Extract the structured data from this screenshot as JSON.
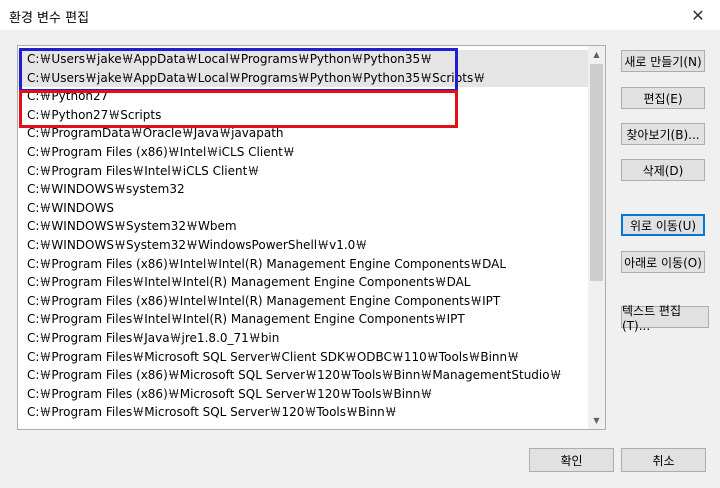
{
  "window": {
    "title": "환경 변수 편집",
    "close_glyph": "✕"
  },
  "entries": [
    "C:￦Users￦jake￦AppData￦Local￦Programs￦Python￦Python35￦",
    "C:￦Users￦jake￦AppData￦Local￦Programs￦Python￦Python35￦Scripts￦",
    "C:￦Python27",
    "C:￦Python27￦Scripts",
    "C:￦ProgramData￦Oracle￦Java￦javapath",
    "C:￦Program Files (x86)￦Intel￦iCLS Client￦",
    "C:￦Program Files￦Intel￦iCLS Client￦",
    "C:￦WINDOWS￦system32",
    "C:￦WINDOWS",
    "C:￦WINDOWS￦System32￦Wbem",
    "C:￦WINDOWS￦System32￦WindowsPowerShell￦v1.0￦",
    "C:￦Program Files (x86)￦Intel￦Intel(R) Management Engine Components￦DAL",
    "C:￦Program Files￦Intel￦Intel(R) Management Engine Components￦DAL",
    "C:￦Program Files (x86)￦Intel￦Intel(R) Management Engine Components￦IPT",
    "C:￦Program Files￦Intel￦Intel(R) Management Engine Components￦IPT",
    "C:￦Program Files￦Java￦jre1.8.0_71￦bin",
    "C:￦Program Files￦Microsoft SQL Server￦Client SDK￦ODBC￦110￦Tools￦Binn￦",
    "C:￦Program Files (x86)￦Microsoft SQL Server￦120￦Tools￦Binn￦ManagementStudio￦",
    "C:￦Program Files (x86)￦Microsoft SQL Server￦120￦Tools￦Binn￦",
    "C:￦Program Files￦Microsoft SQL Server￦120￦Tools￦Binn￦"
  ],
  "buttons": {
    "new": "새로 만들기(N)",
    "edit": "편집(E)",
    "browse": "찾아보기(B)...",
    "delete": "삭제(D)",
    "move_up": "위로 이동(U)",
    "move_down": "아래로 이동(O)",
    "edit_text": "텍스트 편집(T)...",
    "ok": "확인",
    "cancel": "취소"
  },
  "scrollbar": {
    "up_glyph": "▲",
    "down_glyph": "▼"
  },
  "colors": {
    "highlight_blue": "#1f1fcc",
    "highlight_red": "#e0101a",
    "focus": "#0078d7"
  }
}
